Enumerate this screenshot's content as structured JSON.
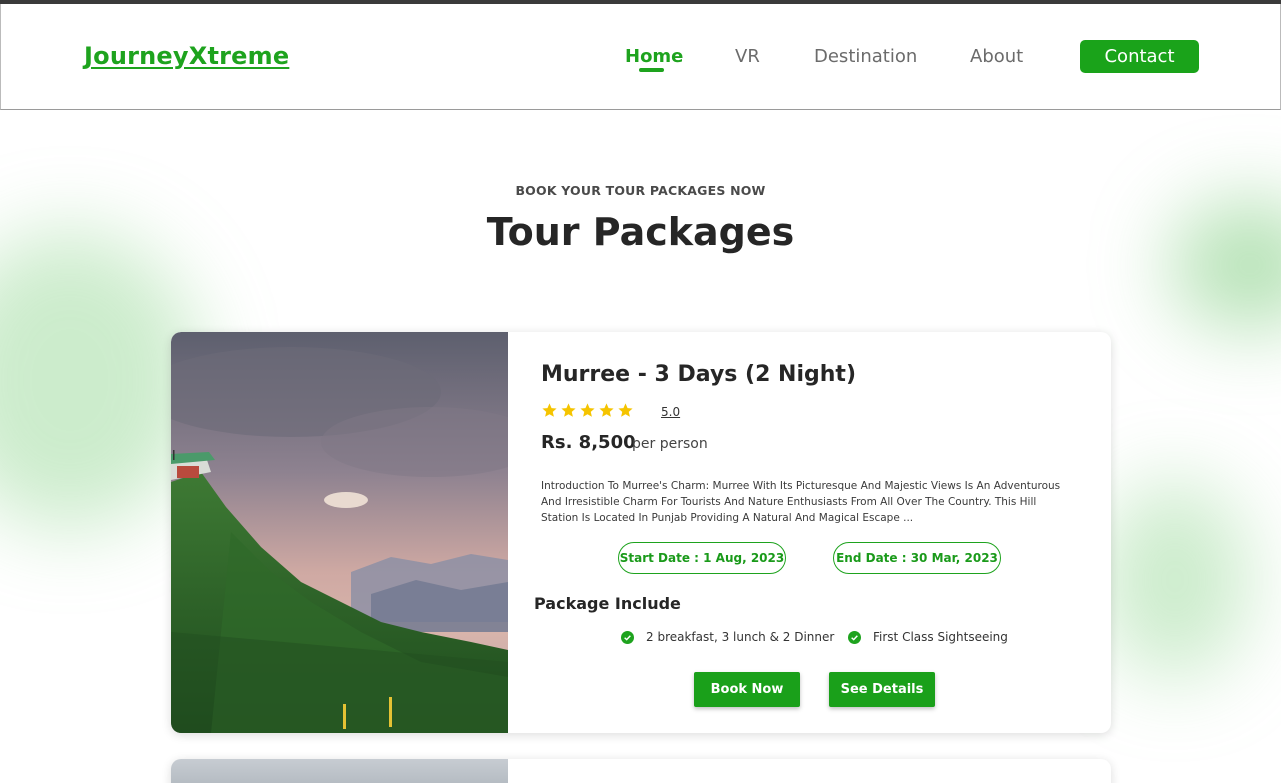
{
  "header": {
    "logo": "JourneyXtreme",
    "nav": [
      "Home",
      "VR",
      "Destination",
      "About"
    ],
    "active_nav": "Home",
    "contact_label": "Contact"
  },
  "section": {
    "eyebrow": "BOOK YOUR TOUR PACKAGES NOW",
    "title": "Tour Packages"
  },
  "packages": [
    {
      "title": "Murree - 3 Days (2 Night)",
      "stars": 5,
      "rating": "5.0",
      "price": "Rs. 8,500",
      "price_unit": "per person",
      "description": "Introduction To Murree's Charm: Murree With Its Picturesque And Majestic Views Is An Adventurous And Irresistible Charm For Tourists And Nature Enthusiasts From All Over The Country. This Hill Station Is Located In Punjab Providing A Natural And Magical Escape ...",
      "start_date": "Start Date : 1 Aug, 2023",
      "end_date": "End Date : 30 Mar, 2023",
      "package_heading": "Package Include",
      "includes": [
        "2 breakfast, 3 lunch & 2 Dinner",
        "First Class Sightseeing"
      ],
      "book_label": "Book Now",
      "details_label": "See Details"
    }
  ],
  "colors": {
    "accent": "#1ea31e",
    "star": "#f5c400",
    "button": "#1aa01a"
  }
}
